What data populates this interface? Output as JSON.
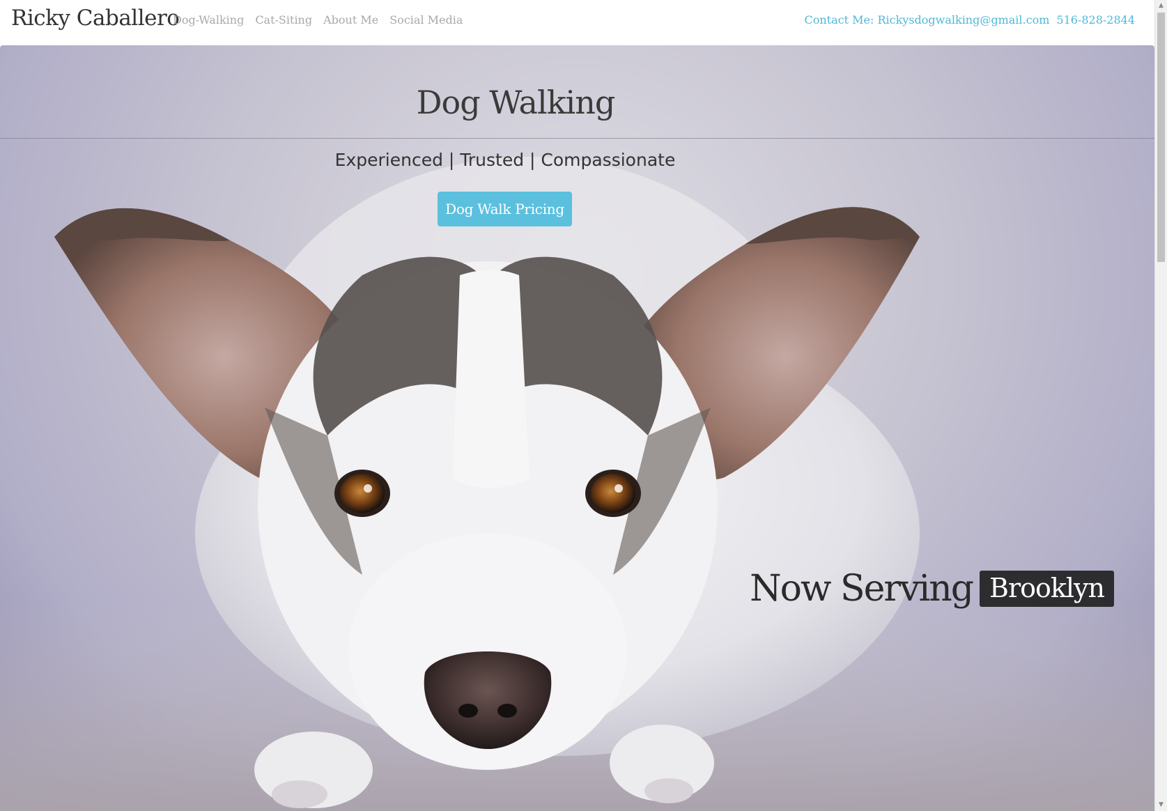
{
  "navbar": {
    "brand": "Ricky Caballero",
    "links": [
      "Dog-Walking",
      "Cat-Siting",
      "About Me",
      "Social Media"
    ],
    "contact_email": "Contact Me: Rickysdogwalking@gmail.com",
    "contact_phone": "516-828-2844"
  },
  "hero": {
    "title": "Dog Walking",
    "subtitle": "Experienced | Trusted | Compassionate",
    "button_label": "Dog Walk Pricing",
    "serving_label": "Now Serving",
    "serving_location": "Brooklyn",
    "image": "dog-photo"
  },
  "colors": {
    "accent": "#5bc0de",
    "contact_text": "#4fb8d8",
    "nav_link": "#a8a8a8",
    "badge_bg": "#2d2d30"
  },
  "scrollbar": {
    "up_arrow": "scroll-up-arrow-icon",
    "down_arrow": "scroll-down-arrow-icon"
  }
}
